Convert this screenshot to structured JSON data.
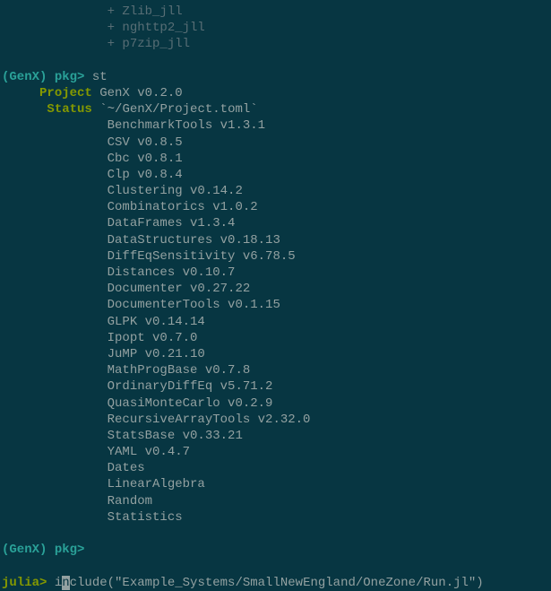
{
  "added_packages": [
    "+ Zlib_jll",
    "+ nghttp2_jll",
    "+ p7zip_jll"
  ],
  "pkg_prompt": {
    "open": "(",
    "name": "GenX",
    "close": ") ",
    "label": "pkg> "
  },
  "st_command": "st",
  "project_label": "Project",
  "project_value": " GenX v0.2.0",
  "status_label": "Status",
  "status_value": " `~/GenX/Project.toml`",
  "packages": [
    "BenchmarkTools v1.3.1",
    "CSV v0.8.5",
    "Cbc v0.8.1",
    "Clp v0.8.4",
    "Clustering v0.14.2",
    "Combinatorics v1.0.2",
    "DataFrames v1.3.4",
    "DataStructures v0.18.13",
    "DiffEqSensitivity v6.78.5",
    "Distances v0.10.7",
    "Documenter v0.27.22",
    "DocumenterTools v0.1.15",
    "GLPK v0.14.14",
    "Ipopt v0.7.0",
    "JuMP v0.21.10",
    "MathProgBase v0.7.8",
    "OrdinaryDiffEq v5.71.2",
    "QuasiMonteCarlo v0.2.9",
    "RecursiveArrayTools v2.32.0",
    "StatsBase v0.33.21",
    "YAML v0.4.7",
    "Dates",
    "LinearAlgebra",
    "Random",
    "Statistics"
  ],
  "julia_prompt": "julia> ",
  "julia_input": {
    "before_cursor": "i",
    "cursor_char": "n",
    "after_cursor": "clude(\"Example_Systems/SmallNewEngland/OneZone/Run.jl\")"
  },
  "indent_added": "              ",
  "indent_pkg": "              "
}
